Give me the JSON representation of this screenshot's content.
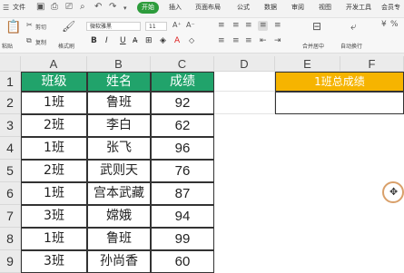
{
  "menu": {
    "items": [
      "文件",
      "开始",
      "插入",
      "页面布局",
      "公式",
      "数据",
      "审阅",
      "视图",
      "开发工具",
      "会员专"
    ],
    "active_tab": "开始"
  },
  "ribbon": {
    "paste_label": "粘贴",
    "cut_label": "剪切",
    "copy_label": "复制",
    "format_painter_label": "格式刷",
    "font_name": "微软雅黑",
    "font_size": "11",
    "merge_label": "合并居中",
    "wrap_label": "自动换行",
    "fmt_buttons": [
      "B",
      "I",
      "U",
      "A",
      "A"
    ]
  },
  "columns": [
    "A",
    "B",
    "C",
    "D",
    "E",
    "F"
  ],
  "rows": [
    "1",
    "2",
    "3",
    "4",
    "5",
    "6",
    "7",
    "8",
    "9"
  ],
  "table": {
    "headers": [
      "班级",
      "姓名",
      "成绩"
    ],
    "data": [
      [
        "1班",
        "鲁班",
        "92"
      ],
      [
        "2班",
        "李白",
        "62"
      ],
      [
        "1班",
        "张飞",
        "96"
      ],
      [
        "2班",
        "武则天",
        "76"
      ],
      [
        "1班",
        "宫本武藏",
        "87"
      ],
      [
        "3班",
        "嫦娥",
        "94"
      ],
      [
        "1班",
        "鲁班",
        "99"
      ],
      [
        "3班",
        "孙尚香",
        "60"
      ]
    ]
  },
  "summary": {
    "label": "1班总成绩",
    "value": ""
  },
  "colors": {
    "header_green": "#21a36b",
    "summary_orange": "#f6b400",
    "active_tab": "#2d9c3c"
  }
}
